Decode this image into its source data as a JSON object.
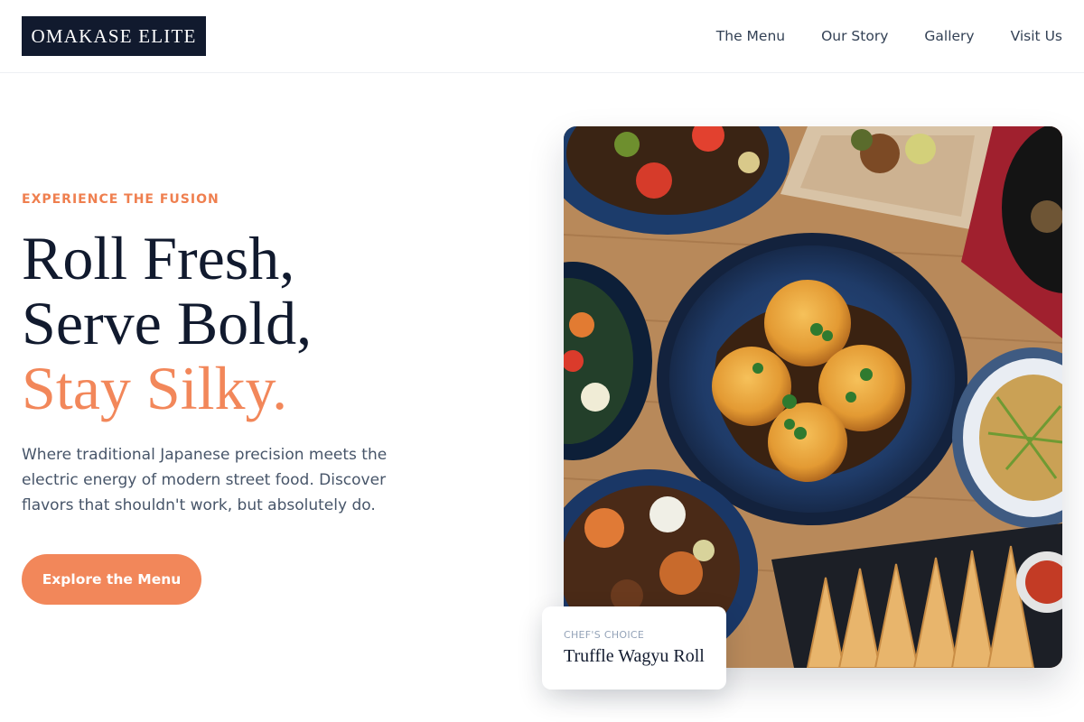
{
  "brand": {
    "name": "OMAKASE ELITE"
  },
  "nav": {
    "items": [
      {
        "label": "The Menu"
      },
      {
        "label": "Our Story"
      },
      {
        "label": "Gallery"
      },
      {
        "label": "Visit Us"
      }
    ]
  },
  "hero": {
    "eyebrow": "EXPERIENCE THE FUSION",
    "headline_line1": "Roll Fresh,",
    "headline_line2": "Serve Bold,",
    "headline_accent": "Stay Silky.",
    "description": "Where traditional Japanese precision meets the electric energy of modern street food. Discover flavors that shouldn't work, but absolutely do.",
    "cta_label": "Explore the Menu"
  },
  "feature": {
    "kicker": "CHEF'S CHOICE",
    "title": "Truffle Wagyu Roll",
    "image_alt": "Overhead spread of Asian fusion dishes on a wooden table"
  },
  "colors": {
    "accent": "#f2875a",
    "navy": "#111a2e",
    "muted": "#475569"
  }
}
